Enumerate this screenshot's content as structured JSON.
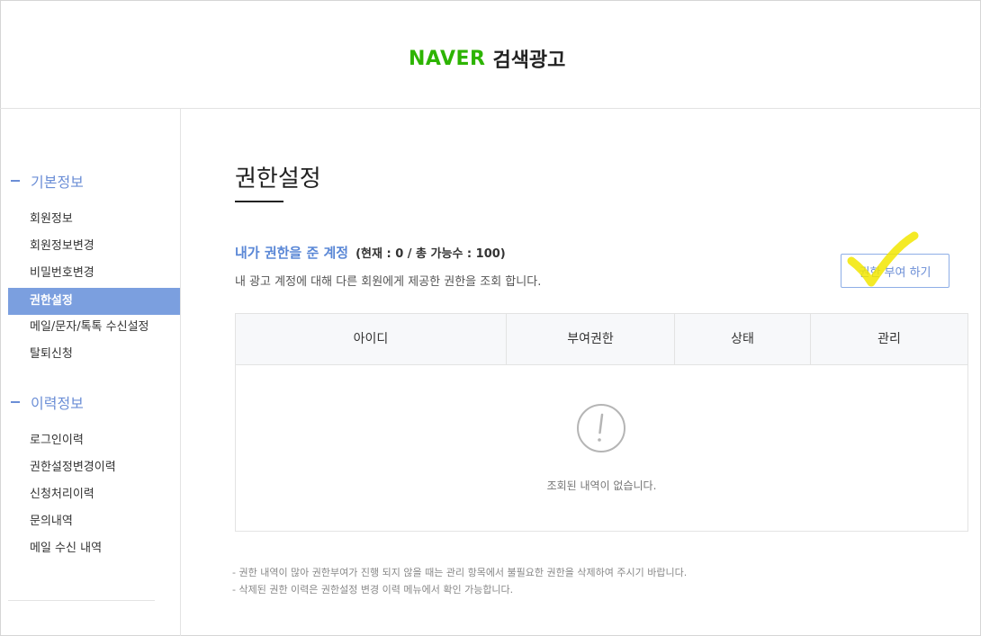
{
  "header": {
    "logo_brand": "NAVER",
    "logo_service": "검색광고"
  },
  "sidebar": {
    "sections": [
      {
        "title": "기본정보",
        "items": [
          "회원정보",
          "회원정보변경",
          "비밀번호변경",
          "권한설정",
          "메일/문자/톡톡 수신설정",
          "탈퇴신청"
        ]
      },
      {
        "title": "이력정보",
        "items": [
          "로그인이력",
          "권한설정변경이력",
          "신청처리이력",
          "문의내역",
          "메일 수신 내역"
        ]
      }
    ],
    "active_item": "권한설정"
  },
  "main": {
    "page_title": "권한설정",
    "sub_title": "내가 권한을 준 계정",
    "count_text": "(현재 : 0 / 총 가능수 : 100)",
    "description": "내 광고 계정에 대해 다른 회원에게 제공한 권한을 조회 합니다.",
    "grant_button": "권한 부여 하기",
    "table": {
      "columns": [
        "아이디",
        "부여권한",
        "상태",
        "관리"
      ],
      "rows": [],
      "empty_message": "조회된 내역이 없습니다."
    },
    "notes": [
      "- 권한 내역이 많아 권한부여가 진행 되지 않을 때는 관리 항목에서 불필요한 권한을 삭제하여 주시기 바랍니다.",
      "- 삭제된 권한 이력은 권한설정 변경 이력 메뉴에서 확인 가능합니다."
    ]
  },
  "colors": {
    "brand_green": "#2db400",
    "accent_blue": "#6b8ed6",
    "active_menu_bg": "#7b9fdf",
    "annotation_yellow": "#f2e600"
  },
  "icons": {
    "empty_state": "exclamation-circle-icon",
    "annotation": "checkmark-icon"
  }
}
